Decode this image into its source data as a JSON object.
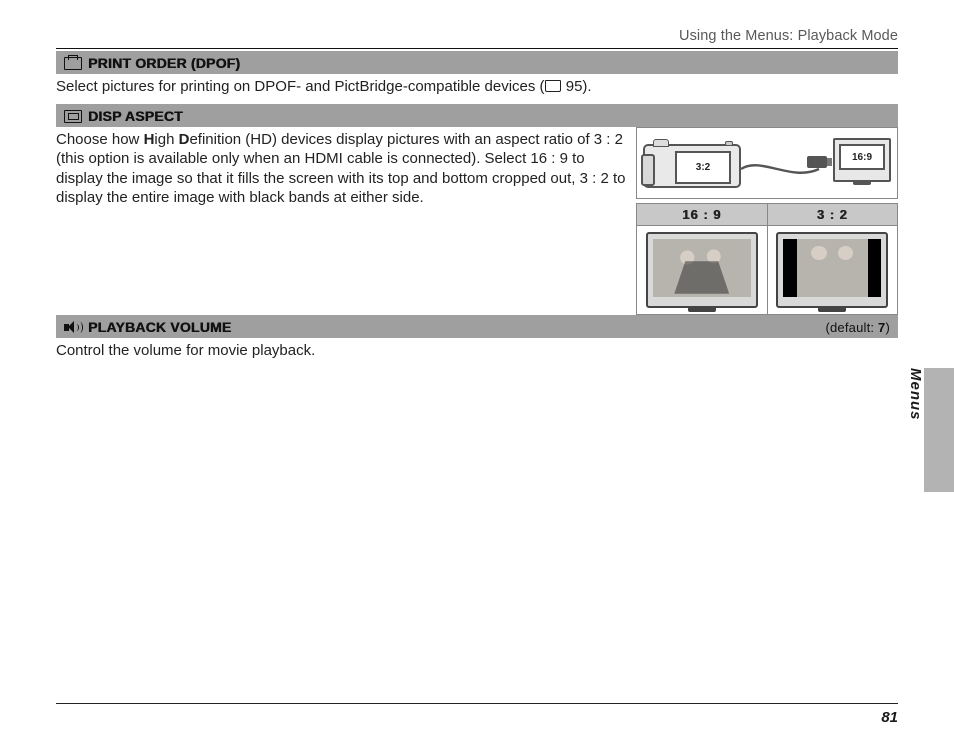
{
  "breadcrumb": "Using the Menus: Playback Mode",
  "side_tab_label": "Menus",
  "page_number": "81",
  "sections": {
    "print_order": {
      "title": "PRINT ORDER (DPOF)",
      "body_pre": "Select pictures for printing on DPOF- and PictBridge-compatible devices (",
      "body_ref": "95",
      "body_post": ")."
    },
    "disp_aspect": {
      "title": "DISP ASPECT",
      "body_l1a": "Choose how ",
      "body_l1_H": "H",
      "body_l1b": "igh ",
      "body_l1_D": "D",
      "body_l1c": "efinition (HD) devices display pictures with an aspect ratio of 3 : 2 (this option is available only when an HDMI cable is connected).  Select 16 : 9 to display the image so that it fills the screen with its top and bottom cropped out, 3 : 2 to display the entire image with black bands at either side.",
      "camera_label": "3:2",
      "tv_small_label": "16:9",
      "col_169": "16 : 9",
      "col_32": "3 : 2"
    },
    "playback_volume": {
      "title": "PLAYBACK VOLUME",
      "default_label": "(default: ",
      "default_value": "7",
      "default_post": ")",
      "body": "Control the volume for movie playback."
    }
  }
}
